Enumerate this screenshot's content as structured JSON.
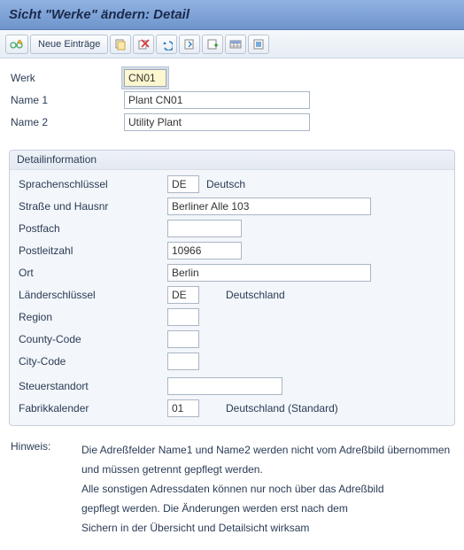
{
  "title": "Sicht \"Werke\" ändern: Detail",
  "toolbar": {
    "new_entries": "Neue Einträge"
  },
  "top": {
    "werk_label": "Werk",
    "werk": "CN01",
    "name1_label": "Name 1",
    "name1": "Plant CN01",
    "name2_label": "Name 2",
    "name2": "Utility Plant"
  },
  "group_title": "Detailinformation",
  "detail": {
    "lang_label": "Sprachenschlüssel",
    "lang": "DE",
    "lang_text": "Deutsch",
    "street_label": "Straße und Hausnr",
    "street": "Berliner Alle 103",
    "pobox_label": "Postfach",
    "pobox": "",
    "zip_label": "Postleitzahl",
    "zip": "10966",
    "city_label": "Ort",
    "city": "Berlin",
    "country_label": "Länderschlüssel",
    "country": "DE",
    "country_text": "Deutschland",
    "region_label": "Region",
    "region": "",
    "county_label": "County-Code",
    "county": "",
    "citycode_label": "City-Code",
    "citycode": "",
    "tax_label": "Steuerstandort",
    "tax": "",
    "cal_label": "Fabrikkalender",
    "cal": "01",
    "cal_text": "Deutschland (Standard)"
  },
  "hint": {
    "label": "Hinweis:",
    "l1": "Die Adreßfelder Name1 und Name2 werden nicht vom Adreßbild übernommen",
    "l2": "und müssen getrennt gepflegt werden.",
    "l3": "Alle sonstigen Adressdaten können nur noch über das Adreßbild",
    "l4": "gepflegt werden. Die Änderungen werden erst nach dem",
    "l5": "Sichern in der Übersicht und Detailsicht wirksam"
  }
}
